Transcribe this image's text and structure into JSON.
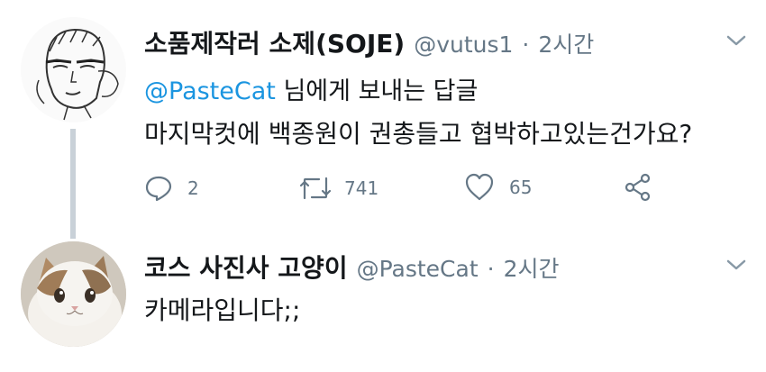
{
  "tweet1": {
    "display_name": "소품제작러 소제(SOJE)",
    "handle": "@vutus1",
    "separator": "·",
    "time": "2시간",
    "reply_mention": "@PasteCat",
    "reply_suffix": "님에게 보내는 답글",
    "text": "마지막컷에 백종원이 권총들고 협박하고있는건가요?",
    "actions": {
      "reply_count": "2",
      "retweet_count": "741",
      "like_count": "65"
    }
  },
  "tweet2": {
    "display_name": "코스 사진사 고양이",
    "handle": "@PasteCat",
    "separator": "·",
    "time": "2시간",
    "text": "카메라입니다;;"
  },
  "colors": {
    "text": "#14171a",
    "secondary": "#657786",
    "accent": "#1b95e0",
    "thread_line": "#c9d1d8"
  },
  "icons": [
    "reply-icon",
    "retweet-icon",
    "like-icon",
    "share-icon",
    "chevron-down-icon"
  ]
}
